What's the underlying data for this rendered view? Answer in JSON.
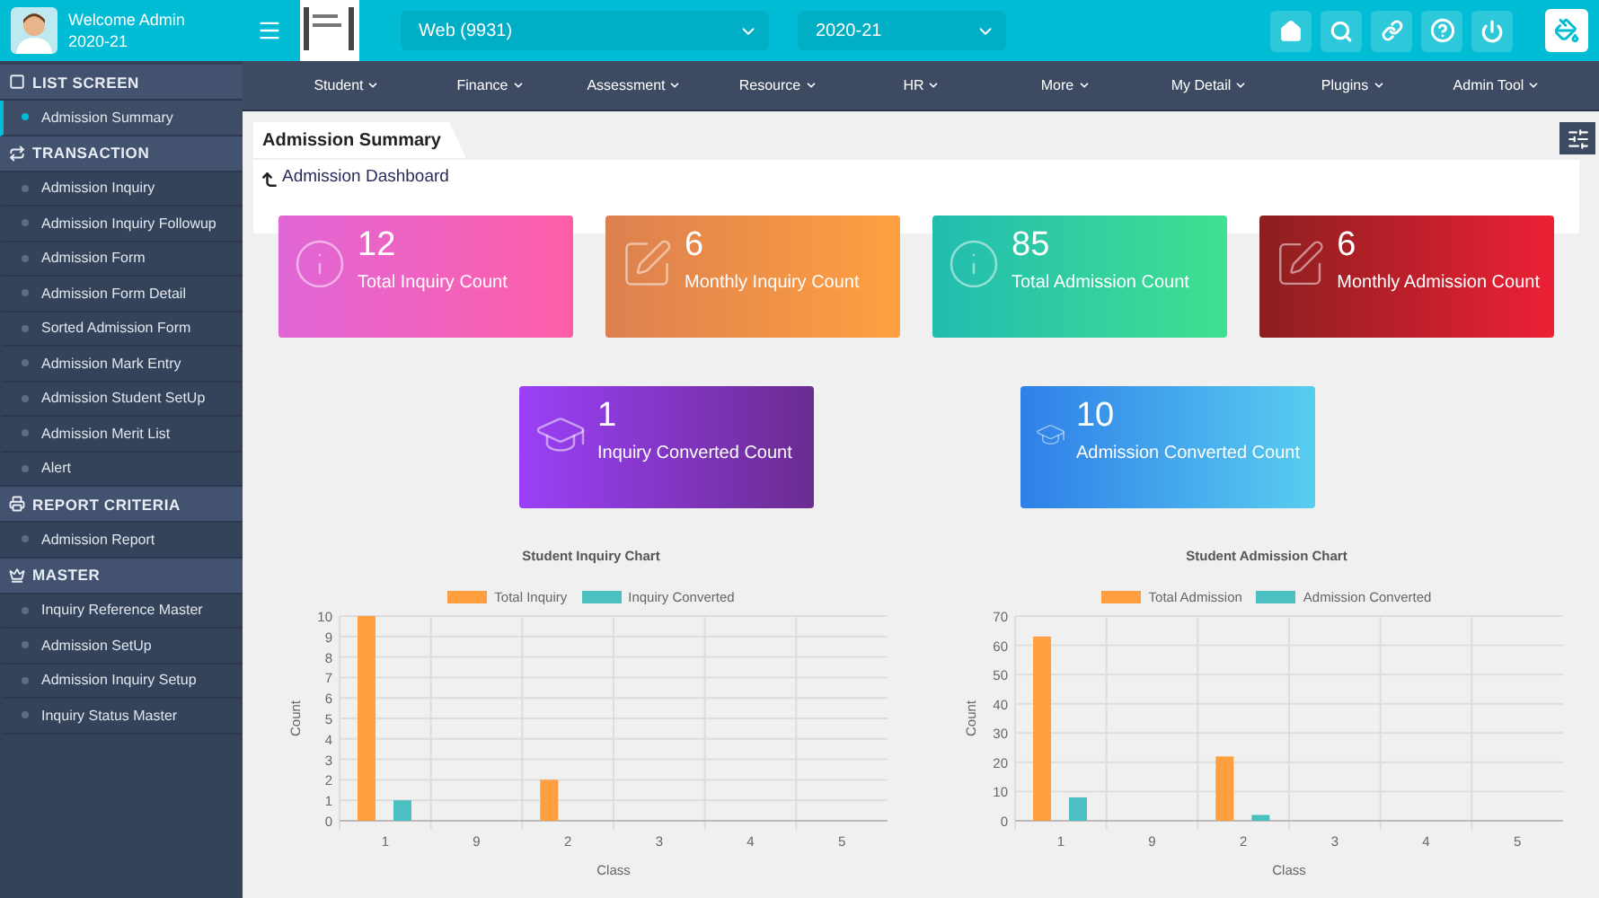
{
  "user": {
    "greeting": "Welcome Admin",
    "year": "2020-21"
  },
  "header": {
    "branch": "Web (9931)",
    "session": "2020-21"
  },
  "sidebar": [
    {
      "title": "LIST SCREEN",
      "items": [
        {
          "label": "Admission Summary",
          "selected": true
        }
      ]
    },
    {
      "title": "TRANSACTION",
      "items": [
        {
          "label": "Admission Inquiry",
          "selected": false
        },
        {
          "label": "Admission Inquiry Followup",
          "selected": false
        },
        {
          "label": "Admission Form",
          "selected": false
        },
        {
          "label": "Admission Form Detail",
          "selected": false
        },
        {
          "label": "Sorted Admission Form",
          "selected": false
        },
        {
          "label": "Admission Mark Entry",
          "selected": false
        },
        {
          "label": "Admission Student SetUp",
          "selected": false
        },
        {
          "label": "Admission Merit List",
          "selected": false
        },
        {
          "label": "Alert",
          "selected": false
        }
      ]
    },
    {
      "title": "REPORT CRITERIA",
      "items": [
        {
          "label": "Admission Report",
          "selected": false
        }
      ]
    },
    {
      "title": "MASTER",
      "items": [
        {
          "label": "Inquiry Reference Master",
          "selected": false
        },
        {
          "label": "Admission SetUp",
          "selected": false
        },
        {
          "label": "Admission Inquiry Setup",
          "selected": false
        },
        {
          "label": "Inquiry Status Master",
          "selected": false
        }
      ]
    }
  ],
  "menu": [
    "Student",
    "Finance",
    "Assessment",
    "Resource",
    "HR",
    "More",
    "My Detail",
    "Plugins",
    "Admin Tool"
  ],
  "tab": "Admission Summary",
  "panel_title": "Admission Dashboard",
  "cards": [
    {
      "kind": "info",
      "value": "12",
      "label": "Total Inquiry Count"
    },
    {
      "kind": "edit",
      "value": "6",
      "label": "Monthly Inquiry Count"
    },
    {
      "kind": "info",
      "value": "85",
      "label": "Total Admission Count"
    },
    {
      "kind": "edit",
      "value": "6",
      "label": "Monthly Admission Count"
    },
    {
      "kind": "cap",
      "value": "1",
      "label": "Inquiry Converted Count"
    },
    {
      "kind": "cap",
      "value": "10",
      "label": "Admission Converted Count"
    }
  ],
  "charts": [
    {
      "chart_data": {
        "type": "bar",
        "grid": true,
        "legend": "top",
        "title": "Student Inquiry Chart",
        "xlabel": "Class",
        "ylabel": "Count",
        "categories": [
          "1",
          "9",
          "2",
          "3",
          "4",
          "5"
        ],
        "ylim": [
          0,
          10
        ],
        "yticks": [
          0,
          1,
          2,
          3,
          4,
          5,
          6,
          7,
          8,
          9,
          10
        ],
        "series": [
          {
            "name": "Total Inquiry",
            "color": "#ff9f40",
            "values": [
              10,
              0,
              2,
              0,
              0,
              0
            ]
          },
          {
            "name": "Inquiry Converted",
            "color": "#4bc0c0",
            "values": [
              1,
              0,
              0,
              0,
              0,
              0
            ]
          }
        ]
      }
    },
    {
      "chart_data": {
        "type": "bar",
        "grid": true,
        "legend": "top",
        "title": "Student Admission Chart",
        "xlabel": "Class",
        "ylabel": "Count",
        "categories": [
          "1",
          "9",
          "2",
          "3",
          "4",
          "5"
        ],
        "ylim": [
          0,
          70
        ],
        "yticks": [
          0,
          10,
          20,
          30,
          40,
          50,
          60,
          70
        ],
        "series": [
          {
            "name": "Total Admission",
            "color": "#ff9f40",
            "values": [
              63,
              0,
              22,
              0,
              0,
              0
            ]
          },
          {
            "name": "Admission Converted",
            "color": "#4bc0c0",
            "values": [
              8,
              0,
              2,
              0,
              0,
              0
            ]
          }
        ]
      }
    }
  ]
}
